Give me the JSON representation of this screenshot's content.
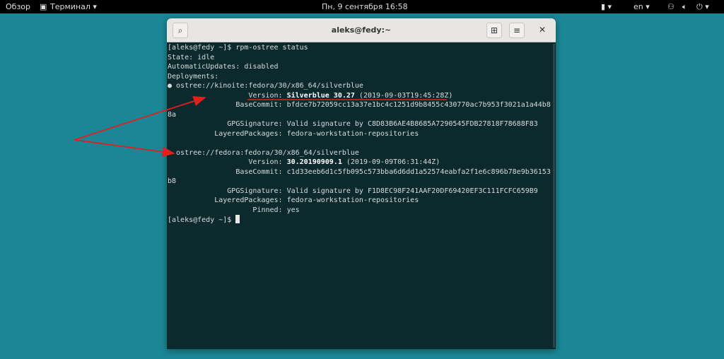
{
  "topbar": {
    "overview": "Обзор",
    "app_menu": "Терминал ▾",
    "clock": "Пн, 9 сентября  16:58",
    "lang": "en ▾",
    "status_icons": "▾"
  },
  "window": {
    "title": "aleks@fedy:~",
    "search_icon": "search-icon",
    "new_tab_icon": "new-tab-icon",
    "menu_icon": "hamburger-icon",
    "close_icon": "close-icon"
  },
  "terminal": {
    "lines": [
      {
        "pre": "[aleks@fedy ~]$ rpm-ostree status"
      },
      {
        "pre": "State: idle"
      },
      {
        "pre": "AutomaticUpdates: disabled"
      },
      {
        "pre": "Deployments:"
      },
      {
        "pre": "● ostree://kinoite:fedora/30/x86_64/silverblue"
      },
      {
        "pre": "                   Version: ",
        "bold": "Silverblue 30.27",
        "post": " (2019-09-03T19:45:28Z)"
      },
      {
        "pre": "                BaseCommit: bfdce7b72059cc13a37e1bc4c1251d9b8455c430770ac7b953f3021a1a44b8"
      },
      {
        "pre": "8a"
      },
      {
        "pre": "              GPGSignature: Valid signature by C8D83B6AE4B8685A7290545FDB27818F78688F83"
      },
      {
        "pre": "           LayeredPackages: fedora-workstation-repositories"
      },
      {
        "pre": ""
      },
      {
        "pre": "  ostree://fedora:fedora/30/x86_64/silverblue"
      },
      {
        "pre": "                   Version: ",
        "bold": "30.20190909.1",
        "post": " (2019-09-09T06:31:44Z)"
      },
      {
        "pre": "                BaseCommit: c1d33eeb6d1c5fb095c573bba6d6dd1a52574eabfa2f1e6c896b78e9b36153"
      },
      {
        "pre": "b8"
      },
      {
        "pre": "              GPGSignature: Valid signature by F1D8EC98F241AAF20DF69420EF3C111FCFC659B9"
      },
      {
        "pre": "           LayeredPackages: fedora-workstation-repositories"
      },
      {
        "pre": "                    Pinned: yes"
      },
      {
        "pre": "[aleks@fedy ~]$ "
      }
    ]
  },
  "annotation": {
    "color": "#e0201c"
  }
}
